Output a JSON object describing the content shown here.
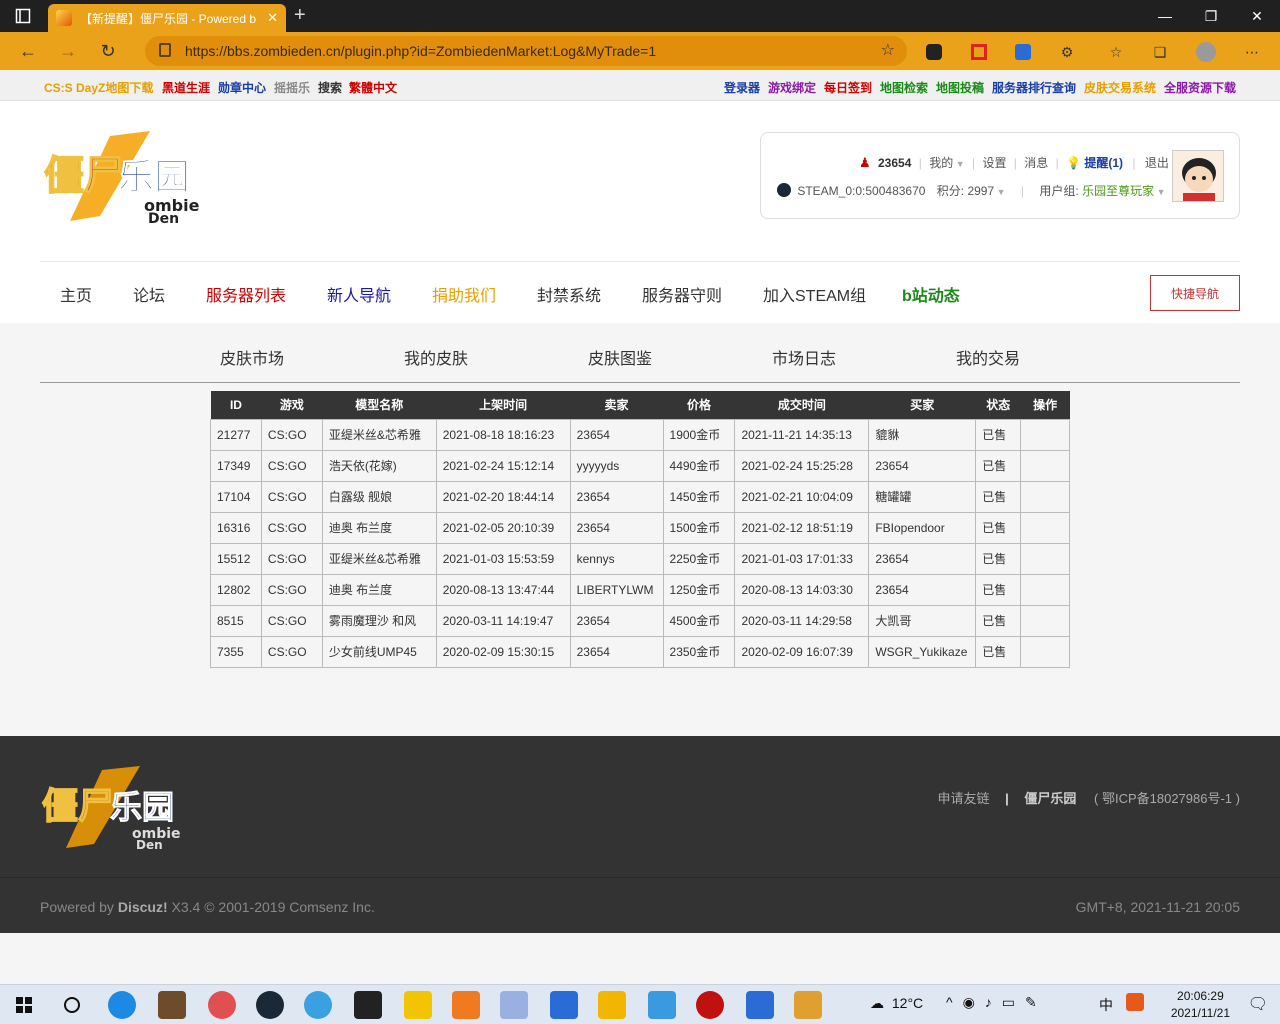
{
  "browser": {
    "tab_title": "【新提醒】僵尸乐园 - Powered b",
    "url": "https://bbs.zombieden.cn/plugin.php?id=ZombiedenMarket:Log&MyTrade=1"
  },
  "toplinks": {
    "left": [
      {
        "label": "CS:S DayZ地图下载",
        "color": "#e8a000"
      },
      {
        "label": "黑道生涯",
        "color": "#d10000"
      },
      {
        "label": "勋章中心",
        "color": "#1a3da8"
      },
      {
        "label": "摇摇乐",
        "color": "#888888"
      },
      {
        "label": "搜索",
        "color": "#333333"
      },
      {
        "label": "繁體中文",
        "color": "#d10000"
      }
    ],
    "right": [
      {
        "label": "登录器",
        "color": "#1a3da8"
      },
      {
        "label": "游戏绑定",
        "color": "#8a1aa8"
      },
      {
        "label": "每日签到",
        "color": "#d10000"
      },
      {
        "label": "地图检索",
        "color": "#1a8a1a"
      },
      {
        "label": "地图投稿",
        "color": "#1a8a1a"
      },
      {
        "label": "服务器排行查询",
        "color": "#1a3da8"
      },
      {
        "label": "皮肤交易系统",
        "color": "#e8a000"
      },
      {
        "label": "全服资源下载",
        "color": "#8a1aa8"
      }
    ]
  },
  "user": {
    "name": "23654",
    "my": "我的",
    "settings": "设置",
    "messages": "消息",
    "reminder": "提醒(1)",
    "logout": "退出",
    "steam_id": "STEAM_0:0:500483670",
    "points": "积分: 2997",
    "group_label": "用户组:",
    "group": "乐园至尊玩家"
  },
  "mainnav": [
    {
      "label": "主页",
      "color": "#333333",
      "bold": false
    },
    {
      "label": "论坛",
      "color": "#333333",
      "bold": false
    },
    {
      "label": "服务器列表",
      "color": "#d10000",
      "bold": false
    },
    {
      "label": "新人导航",
      "color": "#1a1aa8",
      "bold": false
    },
    {
      "label": "捐助我们",
      "color": "#e8a000",
      "bold": false
    },
    {
      "label": "封禁系统",
      "color": "#333333",
      "bold": false
    },
    {
      "label": "服务器守则",
      "color": "#333333",
      "bold": false
    },
    {
      "label": "加入STEAM组",
      "color": "#333333",
      "bold": false
    },
    {
      "label": "b站动态",
      "color": "#1a8a1a",
      "bold": true
    }
  ],
  "quicknav": "快捷导航",
  "subnav": [
    "皮肤市场",
    "我的皮肤",
    "皮肤图鉴",
    "市场日志",
    "我的交易"
  ],
  "table": {
    "headers": [
      "ID",
      "游戏",
      "模型名称",
      "上架时间",
      "卖家",
      "价格",
      "成交时间",
      "买家",
      "状态",
      "操作"
    ],
    "rows": [
      [
        "21277",
        "CS:GO",
        "亚缇米丝&芯希雅",
        "2021-08-18 18:16:23",
        "23654",
        "1900金币",
        "2021-11-21 14:35:13",
        "貔貅",
        "已售",
        ""
      ],
      [
        "17349",
        "CS:GO",
        "浩天依(花嫁)",
        "2021-02-24 15:12:14",
        "yyyyyds",
        "4490金币",
        "2021-02-24 15:25:28",
        "23654",
        "已售",
        ""
      ],
      [
        "17104",
        "CS:GO",
        "白露级 舰娘",
        "2021-02-20 18:44:14",
        "23654",
        "1450金币",
        "2021-02-21 10:04:09",
        "糖罐罐",
        "已售",
        ""
      ],
      [
        "16316",
        "CS:GO",
        "迪奥 布兰度",
        "2021-02-05 20:10:39",
        "23654",
        "1500金币",
        "2021-02-12 18:51:19",
        "FBIopendoor",
        "已售",
        ""
      ],
      [
        "15512",
        "CS:GO",
        "亚缇米丝&芯希雅",
        "2021-01-03 15:53:59",
        "kennys",
        "2250金币",
        "2021-01-03 17:01:33",
        "23654",
        "已售",
        ""
      ],
      [
        "12802",
        "CS:GO",
        "迪奥 布兰度",
        "2020-08-13 13:47:44",
        "LIBERTYLWM",
        "1250金币",
        "2020-08-13 14:03:30",
        "23654",
        "已售",
        ""
      ],
      [
        "8515",
        "CS:GO",
        "雾雨魔理沙 和风",
        "2020-03-11 14:19:47",
        "23654",
        "4500金币",
        "2020-03-11 14:29:58",
        "大凯哥",
        "已售",
        ""
      ],
      [
        "7355",
        "CS:GO",
        "少女前线UMP45",
        "2020-02-09 15:30:15",
        "23654",
        "2350金币",
        "2020-02-09 16:07:39",
        "WSGR_Yukikaze",
        "已售",
        ""
      ]
    ]
  },
  "footer": {
    "link1": "申请友链",
    "sep": "|",
    "link2": "僵尸乐园",
    "icp": "鄂ICP备18027986号-1",
    "powered_by": "Powered by ",
    "discuz": "Discuz!",
    "version": " X3.4 © 2001-2019 Comsenz Inc.",
    "gmt": "GMT+8, 2021-11-21 20:05"
  },
  "taskbar": {
    "weather": "12°C",
    "ime": "中",
    "time": "20:06:29",
    "date": "2021/11/21"
  },
  "icons": {
    "tab_favicon": "zombieden-favicon",
    "back": "back-arrow-icon",
    "forward": "forward-arrow-icon",
    "refresh": "refresh-icon",
    "lock": "lock-icon"
  }
}
